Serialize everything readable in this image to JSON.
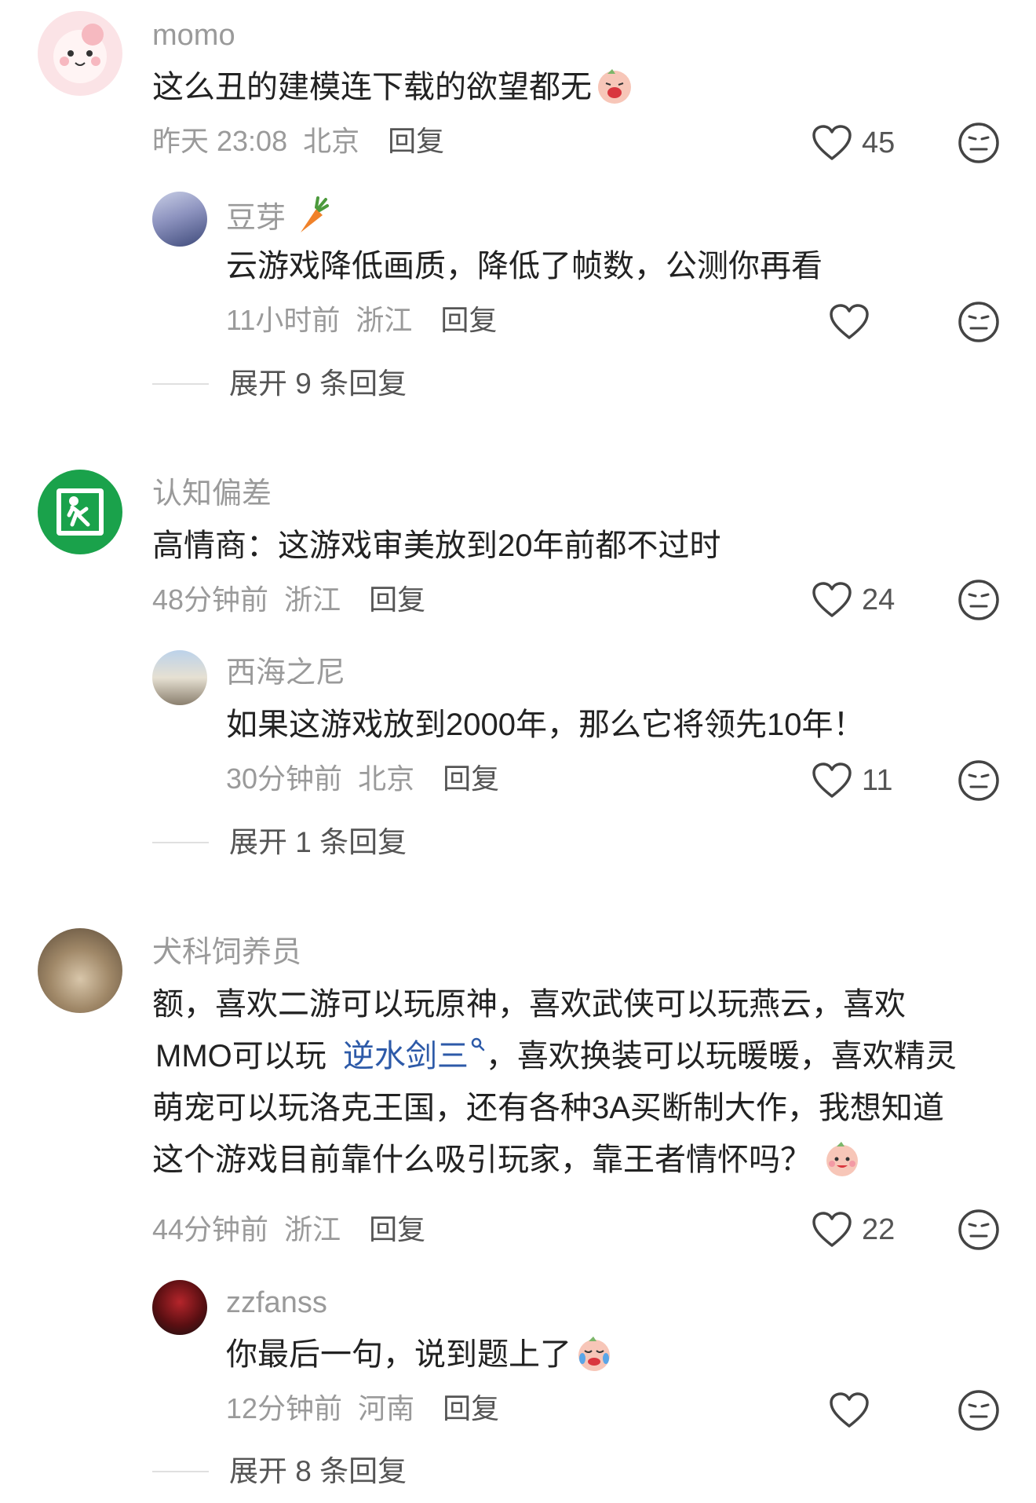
{
  "comments": [
    {
      "author": "momo",
      "text": "这么丑的建模连下载的欲望都无",
      "time": "昨天 23:08",
      "location": "北京",
      "reply_label": "回复",
      "likes": "45",
      "replies": [
        {
          "author": "豆芽",
          "text": "云游戏降低画质，降低了帧数，公测你再看",
          "time": "11小时前",
          "location": "浙江",
          "reply_label": "回复",
          "likes": ""
        }
      ],
      "expand_label": "展开 9 条回复"
    },
    {
      "author": "认知偏差",
      "text": "高情商：这游戏审美放到20年前都不过时",
      "time": "48分钟前",
      "location": "浙江",
      "reply_label": "回复",
      "likes": "24",
      "replies": [
        {
          "author": "西海之尼",
          "text": "如果这游戏放到2000年，那么它将领先10年！",
          "time": "30分钟前",
          "location": "北京",
          "reply_label": "回复",
          "likes": "11"
        }
      ],
      "expand_label": "展开 1 条回复"
    },
    {
      "author": "犬科饲养员",
      "text_lines": [
        "额，喜欢二游可以玩原神，喜欢武侠可以玩燕云，喜欢",
        "MMO可以玩",
        "，喜欢换装可以玩暖暖，喜欢精灵",
        "萌宠可以玩洛克王国，还有各种3A买断制大作，我想知道",
        "这个游戏目前靠什么吸引玩家，靠王者情怀吗？"
      ],
      "link_text": "逆水剑三",
      "time": "44分钟前",
      "location": "浙江",
      "reply_label": "回复",
      "likes": "22",
      "replies": [
        {
          "author": "zzfanss",
          "text": "你最后一句，说到题上了",
          "time": "12分钟前",
          "location": "河南",
          "reply_label": "回复",
          "likes": ""
        }
      ],
      "expand_label": "展开 8 条回复"
    }
  ]
}
